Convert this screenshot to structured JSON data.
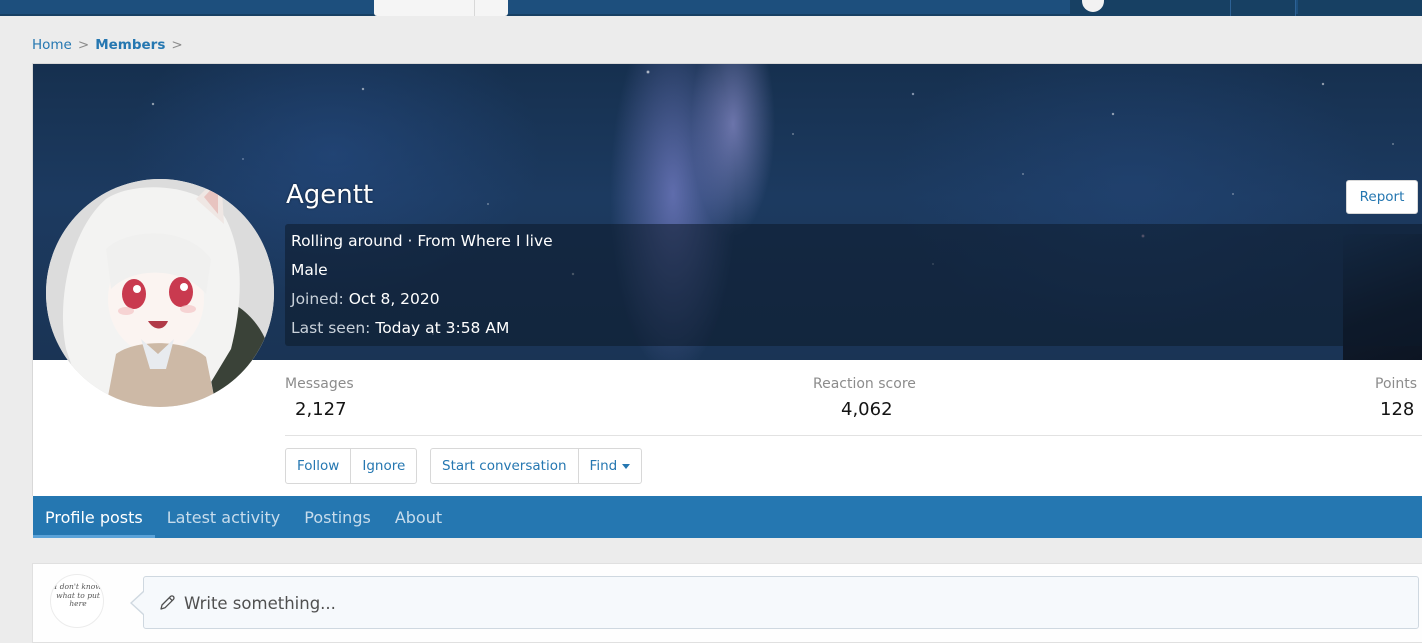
{
  "colors": {
    "header_bg": "#1d4f7d",
    "link": "#2577b1",
    "tab_bar": "#2577b1",
    "page_bg": "#ececec"
  },
  "breadcrumb": {
    "home": "Home",
    "separator": ">",
    "members": "Members"
  },
  "member": {
    "name": "Agentt",
    "status": "Rolling around · From Where I live",
    "gender": "Male",
    "joined_label": "Joined:",
    "joined_value": "Oct 8, 2020",
    "last_seen_label": "Last seen:",
    "last_seen_value": "Today at 3:58 AM",
    "report_label": "Report"
  },
  "stats": {
    "messages_label": "Messages",
    "messages_value": "2,127",
    "reaction_label": "Reaction score",
    "reaction_value": "4,062",
    "points_label": "Points",
    "points_value": "128"
  },
  "actions": {
    "follow": "Follow",
    "ignore": "Ignore",
    "start_conversation": "Start conversation",
    "find": "Find"
  },
  "tabs": [
    {
      "label": "Profile posts",
      "active": true
    },
    {
      "label": "Latest activity",
      "active": false
    },
    {
      "label": "Postings",
      "active": false
    },
    {
      "label": "About",
      "active": false
    }
  ],
  "composer": {
    "placeholder": "Write something...",
    "avatar_text": "I don't know what to put here"
  },
  "icons": {
    "pencil": "pencil-icon",
    "caret": "caret-down-icon"
  }
}
